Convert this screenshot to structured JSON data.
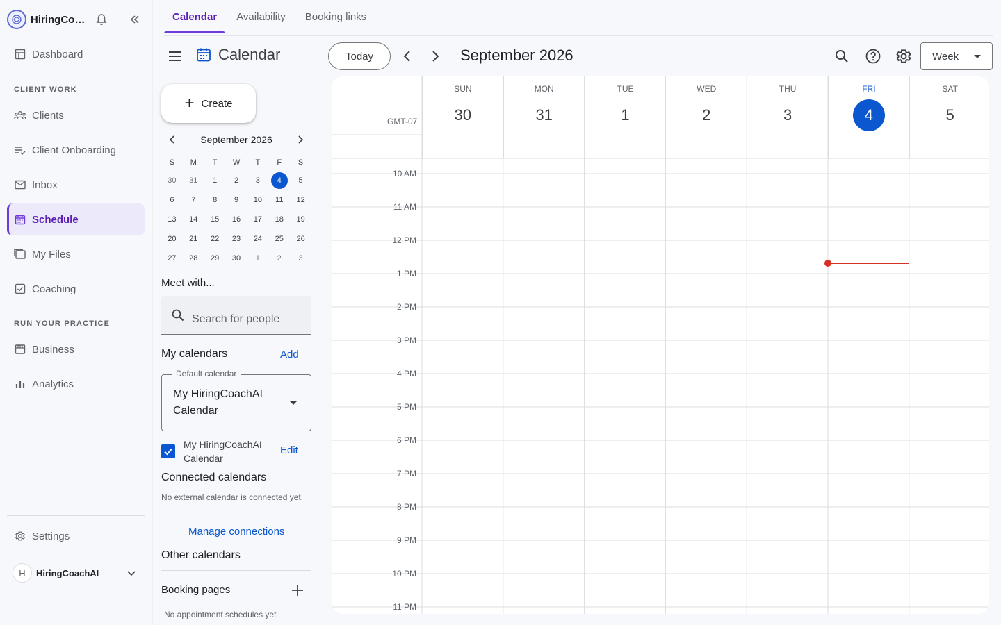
{
  "app": {
    "brand_name": "HiringCoachAI",
    "brand_name_truncated": "HiringCoa..."
  },
  "sidebar": {
    "dashboard": "Dashboard",
    "section_client_work": "CLIENT WORK",
    "clients": "Clients",
    "client_onboarding": "Client Onboarding",
    "inbox": "Inbox",
    "schedule": "Schedule",
    "my_files": "My Files",
    "coaching": "Coaching",
    "section_run_practice": "RUN YOUR PRACTICE",
    "business": "Business",
    "analytics": "Analytics",
    "settings": "Settings",
    "user_initial": "H",
    "user_name": "HiringCoachAI",
    "active_item": "Schedule"
  },
  "tabs": [
    "Calendar",
    "Availability",
    "Booking links"
  ],
  "header": {
    "title": "Calendar",
    "today_label": "Today",
    "month_label": "September 2026",
    "view_label": "Week"
  },
  "panel": {
    "create_label": "Create",
    "mini_month": "September 2026",
    "dow": [
      "S",
      "M",
      "T",
      "W",
      "T",
      "F",
      "S"
    ],
    "weeks": [
      [
        "30",
        "31",
        "1",
        "2",
        "3",
        "4",
        "5"
      ],
      [
        "6",
        "7",
        "8",
        "9",
        "10",
        "11",
        "12"
      ],
      [
        "13",
        "14",
        "15",
        "16",
        "17",
        "18",
        "19"
      ],
      [
        "20",
        "21",
        "22",
        "23",
        "24",
        "25",
        "26"
      ],
      [
        "27",
        "28",
        "29",
        "30",
        "1",
        "2",
        "3"
      ]
    ],
    "meet_with": "Meet with...",
    "search_placeholder": "Search for people",
    "my_calendars": "My calendars",
    "add_label": "Add",
    "default_calendar_legend": "Default calendar",
    "default_calendar_value": "My HiringCoachAI Calendar",
    "calendar_item": "My HiringCoachAI Calendar",
    "edit_label": "Edit",
    "connected_calendars": "Connected calendars",
    "no_external_note": "No external calendar is connected yet.",
    "manage_connections": "Manage connections",
    "other_calendars": "Other calendars",
    "booking_pages": "Booking pages",
    "no_appointments": "No appointment schedules yet"
  },
  "week": {
    "timezone": "GMT-07",
    "days": [
      {
        "dow": "SUN",
        "num": "30"
      },
      {
        "dow": "MON",
        "num": "31"
      },
      {
        "dow": "TUE",
        "num": "1"
      },
      {
        "dow": "WED",
        "num": "2"
      },
      {
        "dow": "THU",
        "num": "3"
      },
      {
        "dow": "FRI",
        "num": "4",
        "today": true
      },
      {
        "dow": "SAT",
        "num": "5"
      }
    ],
    "hours": [
      "10 AM",
      "11 AM",
      "12 PM",
      "1 PM",
      "2 PM",
      "3 PM",
      "4 PM",
      "5 PM",
      "6 PM",
      "7 PM",
      "8 PM",
      "9 PM",
      "10 PM",
      "11 PM"
    ]
  },
  "colors": {
    "accent_purple": "#6d3bd9",
    "primary_blue": "#0b57d0",
    "now_indicator": "#d93025"
  }
}
